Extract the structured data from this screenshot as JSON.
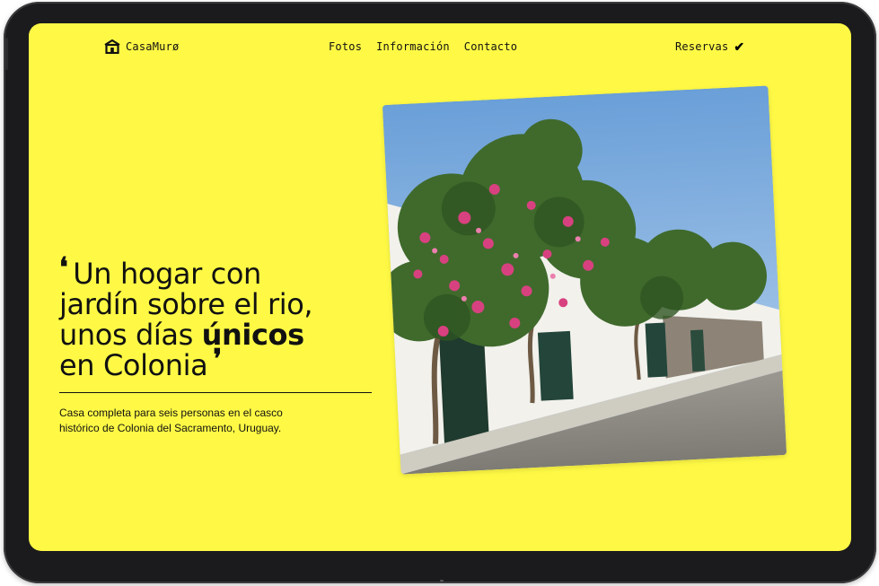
{
  "nav": {
    "brand": "CasaMurø",
    "brand_icon": "house-icon",
    "links": [
      "Fotos",
      "Información",
      "Contacto"
    ],
    "reservations": "Reservas",
    "reservations_icon": "check-icon"
  },
  "hero": {
    "line1": "Un hogar con",
    "line2": "jardín sobre el rio,",
    "line3_prefix": "unos días ",
    "line3_bold": "únicos",
    "line4": "en Colonia",
    "description_line1": "Casa completa para seis personas en el casco",
    "description_line2": "histórico de Colonia del Sacramento, Uruguay."
  },
  "colors": {
    "background": "#fff945",
    "text": "#111111",
    "device_frame": "#1b1b1d"
  }
}
